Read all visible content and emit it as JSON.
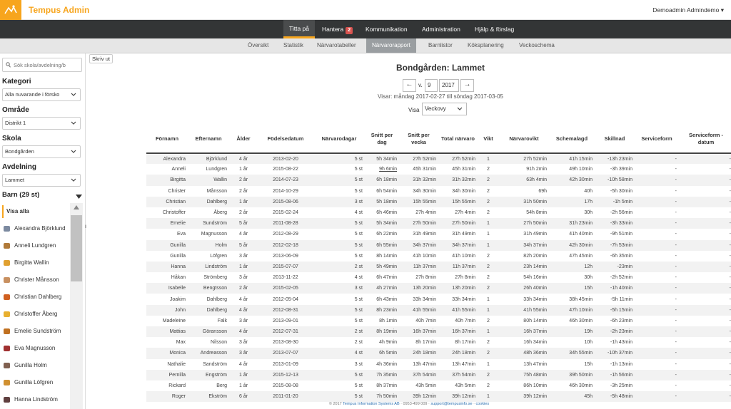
{
  "app": {
    "brand": "Tempus Admin",
    "user": "Demoadmin Admindemo ▾"
  },
  "mainnav": [
    {
      "label": "Titta på"
    },
    {
      "label": "Hantera",
      "badge": "2"
    },
    {
      "label": "Kommunikation"
    },
    {
      "label": "Administration"
    },
    {
      "label": "Hjälp & förslag"
    }
  ],
  "subnav": [
    "Översikt",
    "Statistik",
    "Närvarotabeller",
    "Närvarorapport",
    "Barnlistor",
    "Köksplanering",
    "Veckoschema"
  ],
  "sidebar": {
    "search_placeholder": "Sök skola/avdelning/b",
    "kategori_label": "Kategori",
    "kategori_value": "Alla nuvarande i försko",
    "omrade_label": "Område",
    "omrade_value": "Distrikt 1",
    "skola_label": "Skola",
    "skola_value": "Bondgården",
    "avdelning_label": "Avdelning",
    "avdelning_value": "Lammet",
    "barn_label": "Barn (29 st)",
    "visa_alla": "Visa alla",
    "children": [
      "Alexandra Björklund",
      "Anneli Lundgren",
      "Birgitta Wallin",
      "Christer Månsson",
      "Christian Dahlberg",
      "Christoffer Åberg",
      "Emelie Sundström",
      "Eva Magnusson",
      "Gunilla Holm",
      "Gunilla Löfgren",
      "Hanna Lindström"
    ]
  },
  "report": {
    "print": "Skriv ut",
    "title": "Bondgården: Lammet",
    "v_label": "v.",
    "week": "9",
    "year": "2017",
    "prev": "←",
    "next": "→",
    "range": "Visar: måndag 2017-02-27 till söndag 2017-03-05",
    "visa_label": "Visa",
    "visa_value": "Veckovy",
    "columns": [
      "Förnamn",
      "Efternamn",
      "Ålder",
      "Födelsedatum",
      "Närvarodagar",
      "Snitt per dag",
      "Snitt per vecka",
      "Total närvaro",
      "Vikt",
      "Närvarovikt",
      "Schemalagd",
      "Skillnad",
      "Serviceform",
      "Serviceform - datum"
    ],
    "rows": [
      [
        "Alexandra",
        "Björklund",
        "4 år",
        "2013-02-20",
        "5 st",
        "5h 34min",
        "27h 52min",
        "27h 52min",
        "1",
        "27h 52min",
        "41h 15min",
        "-13h 23min",
        "-",
        "-"
      ],
      [
        "Anneli",
        "Lundgren",
        "1 år",
        "2015-08-22",
        "5 st",
        "9h 6min",
        "45h 31min",
        "45h 31min",
        "2",
        "91h 2min",
        "49h 10min",
        "-3h 39min",
        "-",
        "-"
      ],
      [
        "Birgitta",
        "Wallin",
        "2 år",
        "2014-07-23",
        "5 st",
        "6h 18min",
        "31h 32min",
        "31h 32min",
        "2",
        "63h 4min",
        "42h 30min",
        "-10h 58min",
        "-",
        "-"
      ],
      [
        "Christer",
        "Månsson",
        "2 år",
        "2014-10-29",
        "5 st",
        "6h 54min",
        "34h 30min",
        "34h 30min",
        "2",
        "69h",
        "40h",
        "-5h 30min",
        "-",
        "-"
      ],
      [
        "Christian",
        "Dahlberg",
        "1 år",
        "2015-08-06",
        "3 st",
        "5h 18min",
        "15h 55min",
        "15h 55min",
        "2",
        "31h 50min",
        "17h",
        "-1h 5min",
        "-",
        "-"
      ],
      [
        "Christoffer",
        "Åberg",
        "2 år",
        "2015-02-24",
        "4 st",
        "6h 46min",
        "27h 4min",
        "27h 4min",
        "2",
        "54h 8min",
        "30h",
        "-2h 56min",
        "-",
        "-"
      ],
      [
        "Emelie",
        "Sundström",
        "5 år",
        "2011-08-28",
        "5 st",
        "5h 34min",
        "27h 50min",
        "27h 50min",
        "1",
        "27h 50min",
        "31h 23min",
        "-3h 33min",
        "-",
        "-"
      ],
      [
        "Eva",
        "Magnusson",
        "4 år",
        "2012-08-29",
        "5 st",
        "6h 22min",
        "31h 49min",
        "31h 49min",
        "1",
        "31h 49min",
        "41h 40min",
        "-9h 51min",
        "-",
        "-"
      ],
      [
        "Gunilla",
        "Holm",
        "5 år",
        "2012-02-18",
        "5 st",
        "6h 55min",
        "34h 37min",
        "34h 37min",
        "1",
        "34h 37min",
        "42h 30min",
        "-7h 53min",
        "-",
        "-"
      ],
      [
        "Gunilla",
        "Löfgren",
        "3 år",
        "2013-06-09",
        "5 st",
        "8h 14min",
        "41h 10min",
        "41h 10min",
        "2",
        "82h 20min",
        "47h 45min",
        "-6h 35min",
        "-",
        "-"
      ],
      [
        "Hanna",
        "Lindström",
        "1 år",
        "2015-07-07",
        "2 st",
        "5h 49min",
        "11h 37min",
        "11h 37min",
        "2",
        "23h 14min",
        "12h",
        "-23min",
        "-",
        "-"
      ],
      [
        "Håkan",
        "Strömberg",
        "3 år",
        "2013-11-22",
        "4 st",
        "6h 47min",
        "27h 8min",
        "27h 8min",
        "2",
        "54h 16min",
        "30h",
        "-2h 52min",
        "-",
        "-"
      ],
      [
        "Isabelle",
        "Bengtsson",
        "2 år",
        "2015-02-05",
        "3 st",
        "4h 27min",
        "13h 20min",
        "13h 20min",
        "2",
        "26h 40min",
        "15h",
        "-1h 40min",
        "-",
        "-"
      ],
      [
        "Joakim",
        "Dahlberg",
        "4 år",
        "2012-05-04",
        "5 st",
        "6h 43min",
        "33h 34min",
        "33h 34min",
        "1",
        "33h 34min",
        "38h 45min",
        "-5h 11min",
        "-",
        "-"
      ],
      [
        "John",
        "Dahlberg",
        "4 år",
        "2012-08-31",
        "5 st",
        "8h 23min",
        "41h 55min",
        "41h 55min",
        "1",
        "41h 55min",
        "47h 10min",
        "-5h 15min",
        "-",
        "-"
      ],
      [
        "Madeleine",
        "Falk",
        "3 år",
        "2013-09-01",
        "5 st",
        "8h 1min",
        "40h 7min",
        "40h 7min",
        "2",
        "80h 14min",
        "46h 30min",
        "-6h 23min",
        "-",
        "-"
      ],
      [
        "Mattias",
        "Göransson",
        "4 år",
        "2012-07-31",
        "2 st",
        "8h 19min",
        "16h 37min",
        "16h 37min",
        "1",
        "16h 37min",
        "19h",
        "-2h 23min",
        "-",
        "-"
      ],
      [
        "Max",
        "Nilsson",
        "3 år",
        "2013-08-30",
        "2 st",
        "4h 9min",
        "8h 17min",
        "8h 17min",
        "2",
        "16h 34min",
        "10h",
        "-1h 43min",
        "-",
        "-"
      ],
      [
        "Monica",
        "Andreasson",
        "3 år",
        "2013-07-07",
        "4 st",
        "6h 5min",
        "24h 18min",
        "24h 18min",
        "2",
        "48h 36min",
        "34h 55min",
        "-10h 37min",
        "-",
        "-"
      ],
      [
        "Nathalie",
        "Sandström",
        "4 år",
        "2013-01-09",
        "3 st",
        "4h 36min",
        "13h 47min",
        "13h 47min",
        "1",
        "13h 47min",
        "15h",
        "-1h 13min",
        "-",
        "-"
      ],
      [
        "Pernilla",
        "Engström",
        "1 år",
        "2015-12-13",
        "5 st",
        "7h 35min",
        "37h 54min",
        "37h 54min",
        "2",
        "75h 48min",
        "39h 50min",
        "-1h 56min",
        "-",
        "-"
      ],
      [
        "Rickard",
        "Berg",
        "1 år",
        "2015-08-08",
        "5 st",
        "8h 37min",
        "43h 5min",
        "43h 5min",
        "2",
        "86h 10min",
        "46h 30min",
        "-3h 25min",
        "-",
        "-"
      ],
      [
        "Roger",
        "Ekström",
        "6 år",
        "2011-01-20",
        "5 st",
        "7h 50min",
        "39h 12min",
        "39h 12min",
        "1",
        "39h 12min",
        "45h",
        "-5h 48min",
        "-",
        "-"
      ]
    ]
  },
  "footer": {
    "copy": "© 2017",
    "company": "Tempus Information Systems AB",
    "phone": "· 0953-499 009 ·",
    "email": "support@tempusinfo.se",
    "sep": "·",
    "cookies": "cookies"
  },
  "colors": {
    "accent": "#f7a51d",
    "nav_bg": "#333536",
    "badge": "#d9534f"
  },
  "icons": [
    "tempus-logo-icon",
    "search-icon",
    "chevron-down-icon",
    "triangle-down-icon",
    "arrow-left-icon",
    "arrow-right-icon",
    "child-avatar-icon"
  ]
}
